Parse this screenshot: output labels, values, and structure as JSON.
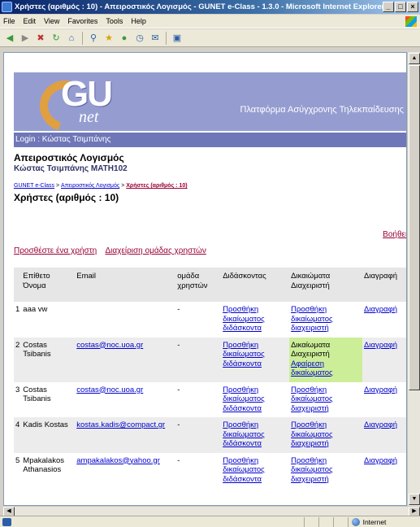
{
  "window": {
    "title": "Χρήστες (αριθμός : 10) - Απειροστικός Λογισμός - GUNET e-Class - 1.3.0 - Microsoft Internet Explorer",
    "buttons": [
      "_",
      "□",
      "×"
    ]
  },
  "menu": [
    "File",
    "Edit",
    "View",
    "Favorites",
    "Tools",
    "Help"
  ],
  "toolbar": [
    "back-icon",
    "forward-icon",
    "stop-icon",
    "refresh-icon",
    "home-icon",
    "search-icon",
    "favorites-icon",
    "media-icon",
    "history-icon",
    "mail-icon",
    "print-icon"
  ],
  "banner": {
    "logo_main": "GU",
    "logo_sub": "net",
    "tagline": "Πλατφόρμα Ασύγχρονης Τηλεκπαίδευσης"
  },
  "login": "Login : Κώστας Τσιμπάνης",
  "course": {
    "title": "Απειροστικός Λογισμός",
    "subtitle": "Κώστας Τσιμπάνης MATH102"
  },
  "breadcrumb": {
    "home": "GUNET e-Class",
    "sep": ">",
    "course": "Απειροστικός Λογισμός",
    "current": "Χρήστες (αριθμός : 10)"
  },
  "page_title": "Χρήστες (αριθμός : 10)",
  "help": "Βοήθεια",
  "actions": {
    "add_user": "Προσθέστε ένα χρήστη",
    "manage_groups": "Διαχείριση ομάδας χρηστών"
  },
  "table": {
    "headers": [
      "",
      "Επίθετο Όνομα",
      "Email",
      "ομάδα χρηστών",
      "Διδάσκοντας",
      "Δικαιώματα Διαχειριστή",
      "Διαγραφή"
    ],
    "rows": [
      {
        "num": "1",
        "name": "aaa vw",
        "email": "",
        "group": "-",
        "teacher": "Προσθήκη δικαίωματος διδάσκοντα",
        "admin": "Προσθήκη δικαίωματος διαχειριστή",
        "admin_on": false,
        "delete": "Διαγραφή"
      },
      {
        "num": "2",
        "name": "Costas Tsibanis",
        "email": "costas@noc.uoa.gr",
        "group": "-",
        "teacher": "Προσθήκη δικαίωματος διδάσκοντα",
        "admin": "Δικαίωματα Διαχειριστή",
        "admin_link": "Αφαίρεση δικαίωματος",
        "admin_on": true,
        "delete": "Διαγραφή"
      },
      {
        "num": "3",
        "name": "Costas Tsibanis",
        "email": "costas@noc.uoa.gr",
        "group": "-",
        "teacher": "Προσθήκη δικαίωματος διδάσκοντα",
        "admin": "Προσθήκη δικαίωματος διαχειριστή",
        "admin_on": false,
        "delete": "Διαγραφή"
      },
      {
        "num": "4",
        "name": "Kadis Kostas",
        "email": "kostas.kadis@compact.gr",
        "group": "-",
        "teacher": "Προσθήκη δικαίωματος διδάσκοντα",
        "admin": "Προσθήκη δικαίωματος διαχειριστή",
        "admin_on": false,
        "delete": "Διαγραφή"
      },
      {
        "num": "5",
        "name": "Mpakalakos Athanasios",
        "email": "ampakalakos@yahoo.gr",
        "group": "-",
        "teacher": "Προσθήκη δικαίωματος διδάσκοντα",
        "admin": "Προσθήκη δικαίωματος διαχειριστή",
        "admin_on": false,
        "delete": "Διαγραφή"
      }
    ]
  },
  "status": {
    "zone": "Internet"
  },
  "colors": {
    "banner": "#959dd0",
    "login_bar": "#6f77b8",
    "admin_highlight": "#ccee99",
    "link": "#0000cc",
    "accent_link": "#990033"
  }
}
